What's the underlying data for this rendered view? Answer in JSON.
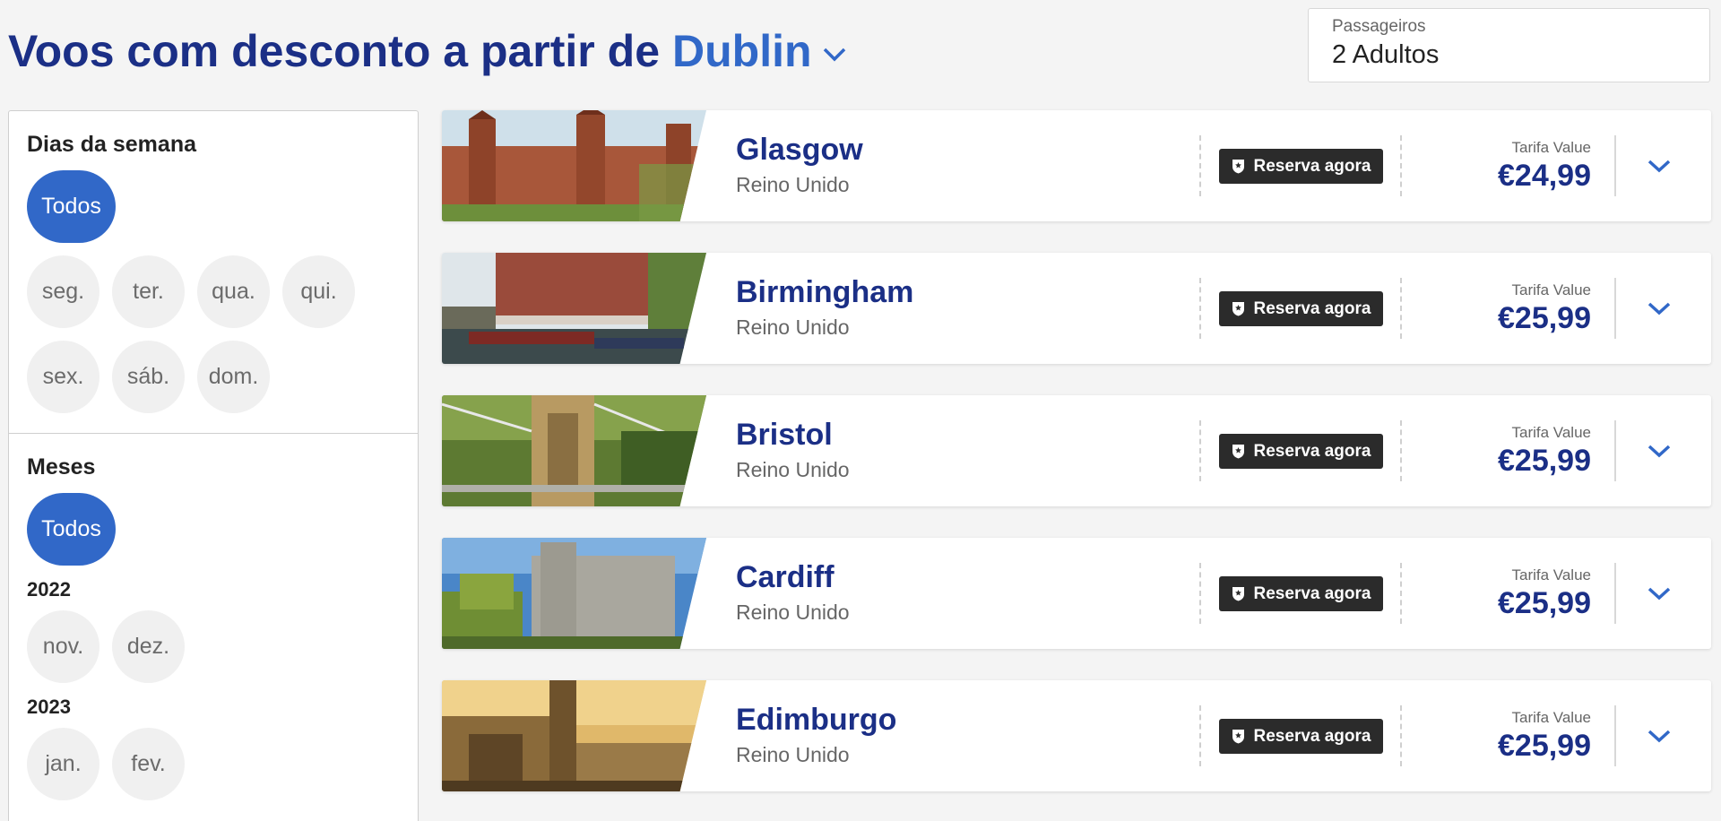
{
  "header": {
    "title_prefix": "Voos com desconto a partir de",
    "origin_city": "Dublin",
    "origin_icon": "chevron-down-icon"
  },
  "passengers": {
    "label": "Passageiros",
    "value": "2 Adultos"
  },
  "filters": {
    "days": {
      "heading": "Dias da semana",
      "all": "Todos",
      "items": [
        "seg.",
        "ter.",
        "qua.",
        "qui.",
        "sex.",
        "sáb.",
        "dom."
      ]
    },
    "months": {
      "heading": "Meses",
      "all": "Todos",
      "years": [
        {
          "year": "2022",
          "months": [
            "nov.",
            "dez."
          ]
        },
        {
          "year": "2023",
          "months": [
            "jan.",
            "fev."
          ]
        }
      ]
    }
  },
  "colors": {
    "brand_dark": "#1b2f86",
    "brand_accent": "#3168c8",
    "button_dark": "#2b2b2b"
  },
  "results": [
    {
      "city": "Glasgow",
      "country": "Reino Unido",
      "book_label": "Reserva agora",
      "fare_label": "Tarifa Value",
      "price": "€24,99"
    },
    {
      "city": "Birmingham",
      "country": "Reino Unido",
      "book_label": "Reserva agora",
      "fare_label": "Tarifa Value",
      "price": "€25,99"
    },
    {
      "city": "Bristol",
      "country": "Reino Unido",
      "book_label": "Reserva agora",
      "fare_label": "Tarifa Value",
      "price": "€25,99"
    },
    {
      "city": "Cardiff",
      "country": "Reino Unido",
      "book_label": "Reserva agora",
      "fare_label": "Tarifa Value",
      "price": "€25,99"
    },
    {
      "city": "Edimburgo",
      "country": "Reino Unido",
      "book_label": "Reserva agora",
      "fare_label": "Tarifa Value",
      "price": "€25,99"
    }
  ]
}
